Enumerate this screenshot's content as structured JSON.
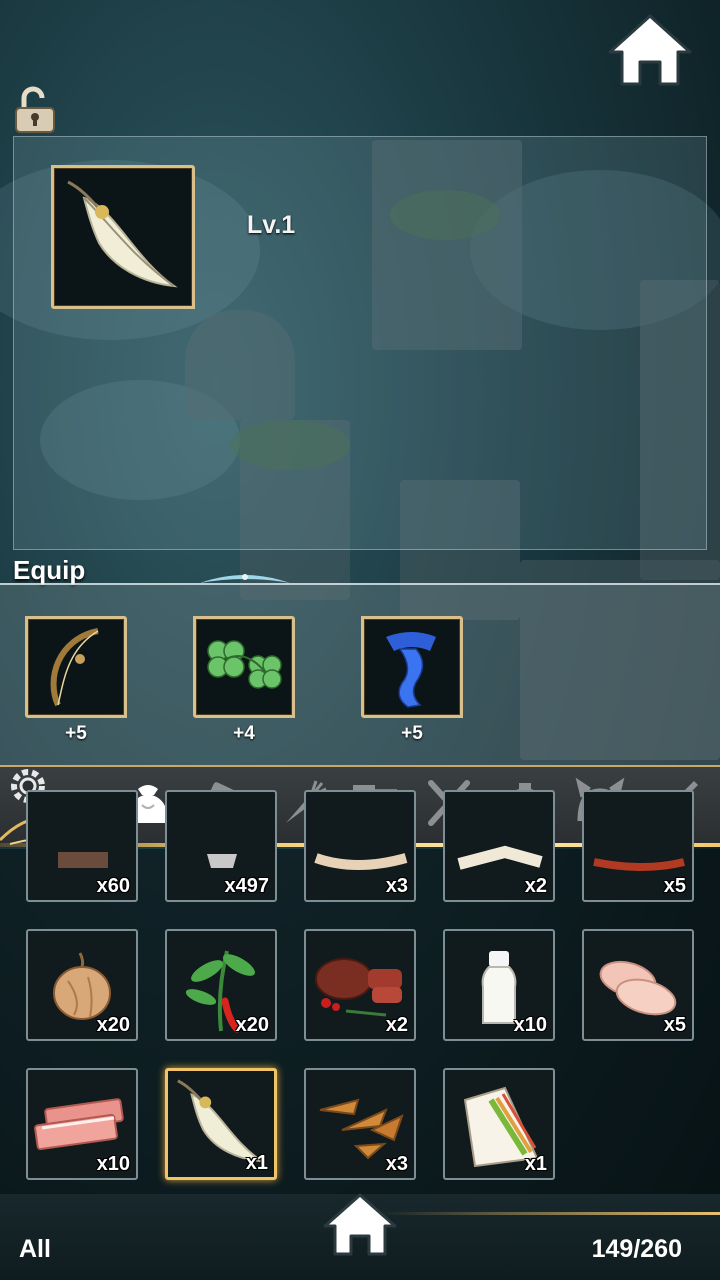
{
  "detail": {
    "level": "Lv.1",
    "item_icon": "feather-icon"
  },
  "equip": {
    "title": "Equip",
    "slots": [
      {
        "icon": "bow-icon",
        "bonus": "+5"
      },
      {
        "icon": "clover-icon",
        "bonus": "+4"
      },
      {
        "icon": "scarf-icon",
        "bonus": "+5"
      }
    ]
  },
  "tabs": [
    {
      "icon": "bag-icon",
      "active": true
    },
    {
      "icon": "ticket-icon",
      "active": false
    },
    {
      "icon": "carrot-icon",
      "active": false
    },
    {
      "icon": "books-icon",
      "active": false
    },
    {
      "icon": "cutlery-icon",
      "active": false
    },
    {
      "icon": "ring-icon",
      "active": false
    },
    {
      "icon": "headband-icon",
      "active": false
    },
    {
      "icon": "sword-icon",
      "active": false
    }
  ],
  "items": [
    {
      "icon": "food-item-icon",
      "qty": "x60"
    },
    {
      "icon": "material-item-icon",
      "qty": "x497"
    },
    {
      "icon": "food-item-icon",
      "qty": "x3"
    },
    {
      "icon": "food-item-icon",
      "qty": "x2"
    },
    {
      "icon": "food-item-icon",
      "qty": "x5"
    },
    {
      "icon": "onion-icon",
      "qty": "x20"
    },
    {
      "icon": "pepper-plant-icon",
      "qty": "x20"
    },
    {
      "icon": "steak-icon",
      "qty": "x2"
    },
    {
      "icon": "milk-bottle-icon",
      "qty": "x10"
    },
    {
      "icon": "chicken-breast-icon",
      "qty": "x5"
    },
    {
      "icon": "bacon-icon",
      "qty": "x10"
    },
    {
      "icon": "feather-icon",
      "qty": "x1",
      "selected": true
    },
    {
      "icon": "potato-wedges-icon",
      "qty": "x3"
    },
    {
      "icon": "sandwich-icon",
      "qty": "x1"
    }
  ],
  "footer": {
    "filter": "All",
    "capacity": "149/260"
  },
  "colors": {
    "selection_gold": "#f0c467",
    "frame_gold": "#d9c08a",
    "slot_border": "#7d8f94"
  }
}
